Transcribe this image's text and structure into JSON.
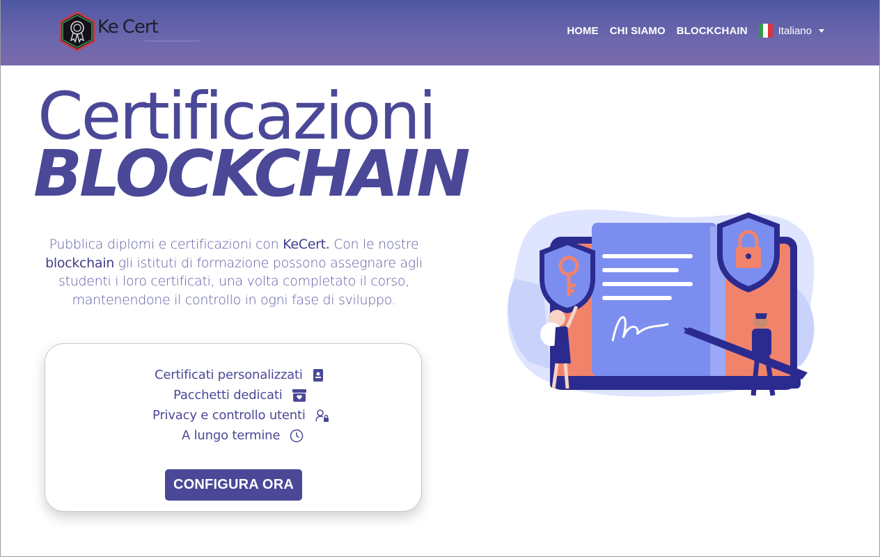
{
  "header": {
    "logo_text_ke": "Ke",
    "logo_text_cert": "Cert",
    "nav": {
      "home": "HOME",
      "about": "CHI SIAMO",
      "blockchain": "BLOCKCHAIN"
    },
    "language": {
      "label": "Italiano",
      "flag_icon": "italy-flag-icon"
    }
  },
  "hero": {
    "title_line1": "Certificazioni",
    "title_line2": "BLOCKCHAIN",
    "intro": {
      "p1": "Pubblica diplomi e certificazioni con ",
      "brand": "KeCert.",
      "p2": " Con le nostre",
      "keyword": "blockchain",
      "p3": " gli istituti di formazione possono assegnare agli studenti i loro certificati, una volta completato il corso, mantenendone il controllo in ogni fase di sviluppo."
    }
  },
  "features": {
    "items": [
      {
        "label": "Certificati personalizzati",
        "icon": "certificate-icon"
      },
      {
        "label": "Pacchetti dedicati",
        "icon": "package-heart-icon"
      },
      {
        "label": "Privacy e controllo utenti",
        "icon": "user-lock-icon"
      },
      {
        "label": "A lungo termine",
        "icon": "clock-icon"
      }
    ],
    "cta_label": "CONFIGURA ORA"
  },
  "colors": {
    "primary": "#4a4897",
    "header_gradient_top": "#4e57a2",
    "header_gradient_bottom": "#7a6aac",
    "accent_salmon": "#f2836b",
    "accent_blue": "#7b8ef0"
  }
}
